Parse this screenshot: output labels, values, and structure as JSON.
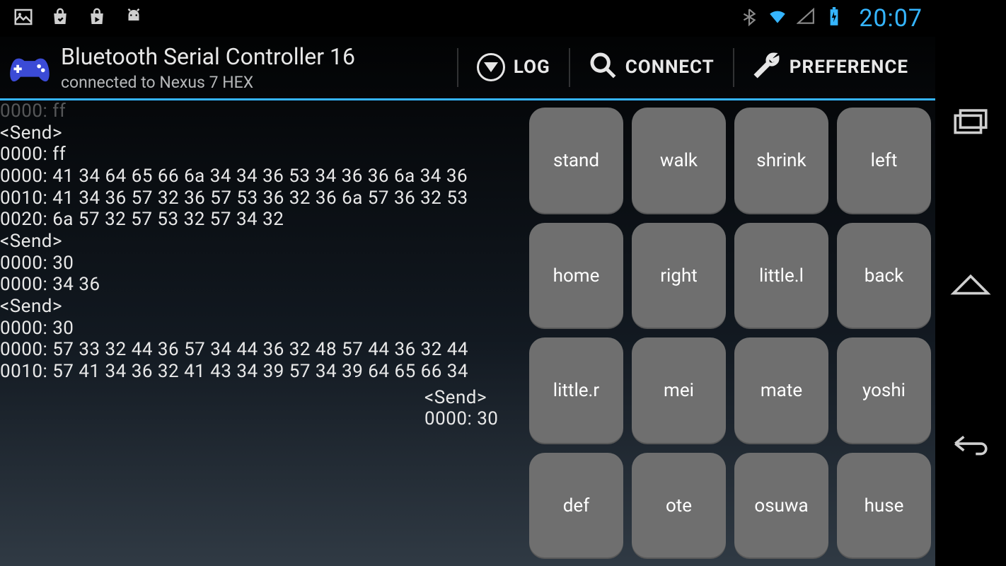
{
  "status": {
    "clock": "20:07"
  },
  "app": {
    "title": "Bluetooth Serial Controller 16",
    "subtitle": "connected to Nexus 7  HEX"
  },
  "actions": {
    "log": "LOG",
    "connect": "CONNECT",
    "preference": "PREFERENCE"
  },
  "log": {
    "lines": [
      "0000: ff",
      "",
      "<Send>",
      "0000: ff",
      "",
      "0000: 41 34 64 65 66 6a 34 34 36 53 34 36 36 6a 34 36",
      "0010: 41 34 36 57 32 36 57 53 36 32 36 6a 57 36 32 53",
      "0020: 6a 57 32 57 53 32 57 34 32",
      "",
      "<Send>",
      "0000: 30",
      "",
      "0000: 34 36",
      "",
      "<Send>",
      "0000: 30",
      "",
      "0000: 57 33 32 44 36 57 34 44 36 32 48 57 44 36 32 44",
      "0010: 57 41 34 36 32 41 43 34 39 57 34 39 64 65 66 34"
    ],
    "tail": [
      "<Send>",
      "0000: 30"
    ]
  },
  "buttons": [
    [
      "stand",
      "walk",
      "shrink",
      "left"
    ],
    [
      "home",
      "right",
      "little.l",
      "back"
    ],
    [
      "little.r",
      "mei",
      "mate",
      "yoshi"
    ],
    [
      "def",
      "ote",
      "osuwa",
      "huse"
    ]
  ]
}
